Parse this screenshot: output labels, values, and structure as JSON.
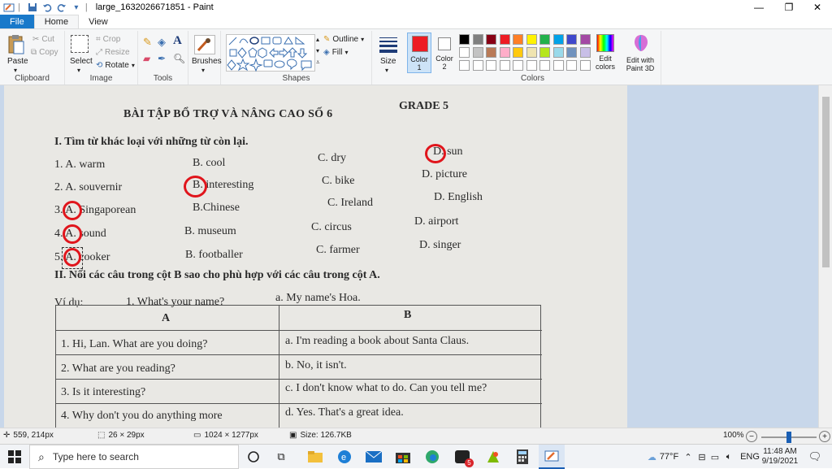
{
  "window": {
    "title": "large_1632026671851 - Paint",
    "qat_separator": "|"
  },
  "tabs": [
    "File",
    "Home",
    "View"
  ],
  "ribbon": {
    "clipboard": {
      "label": "Clipboard",
      "paste": "Paste",
      "cut": "Cut",
      "copy": "Copy"
    },
    "image": {
      "label": "Image",
      "select": "Select",
      "crop": "Crop",
      "resize": "Resize",
      "rotate": "Rotate"
    },
    "tools": {
      "label": "Tools"
    },
    "brushes": {
      "label": "Brushes"
    },
    "shapes": {
      "label": "Shapes",
      "outline": "Outline",
      "fill": "Fill"
    },
    "size": {
      "label": "Size"
    },
    "colors": {
      "label": "Colors",
      "color1": "Color 1",
      "color2": "Color 2",
      "edit_colors": "Edit colors",
      "edit_paint3d": "Edit with Paint 3D",
      "color1_value": "#ed1c24",
      "color2_value": "#ffffff",
      "palette_row1": [
        "#000000",
        "#7f7f7f",
        "#880015",
        "#ed1c24",
        "#ff7f27",
        "#fff200",
        "#22b14c",
        "#00a2e8",
        "#3f48cc",
        "#a349a4"
      ],
      "palette_row2": [
        "#ffffff",
        "#c3c3c3",
        "#b97a57",
        "#ffaec9",
        "#ffc90e",
        "#efe4b0",
        "#b5e61d",
        "#99d9ea",
        "#7092be",
        "#c8bfe7"
      ]
    }
  },
  "document": {
    "title": "BÀI TẬP BỔ TRỢ VÀ NÂNG CAO SỐ 6",
    "grade": "GRADE 5",
    "section1": "I. Tìm từ khác loại với những từ còn lại.",
    "rows": [
      [
        "1. A. warm",
        "B. cool",
        "C. dry",
        "D. sun"
      ],
      [
        "2. A. souvernir",
        "B. interesting",
        "C. bike",
        "D. picture"
      ],
      [
        "3. A. Singaporean",
        "B.Chinese",
        "C. Ireland",
        "D. English"
      ],
      [
        "4. A. sound",
        "B. museum",
        "C. circus",
        "D. airport"
      ],
      [
        "5. A. cooker",
        "B. footballer",
        "C. farmer",
        "D. singer"
      ]
    ],
    "section2": "II. Nối các câu trong cột B sao cho phù hợp với các câu trong cột A.",
    "example_label": "Ví dụ:",
    "example_q": "1. What's your name?",
    "example_a": "a. My name's Hoa.",
    "table": {
      "headers": [
        "A",
        "B"
      ],
      "rows": [
        [
          "1. Hi, Lan. What are you doing?",
          "a. I'm reading a book about Santa Claus."
        ],
        [
          "2. What are you reading?",
          "b. No, it isn't."
        ],
        [
          "3. Is it interesting?",
          "c. I don't know what to do. Can you tell me?"
        ],
        [
          "4. Why don't you do anything more",
          "d. Yes. That's a great idea."
        ]
      ]
    }
  },
  "status": {
    "cursor": "559, 214px",
    "selection": "26 × 29px",
    "image_size": "1024 × 1277px",
    "file_size": "Size: 126.7KB",
    "zoom": "100%",
    "zoom_level": 0.5
  },
  "taskbar": {
    "search_placeholder": "Type here to search",
    "weather": "77°F",
    "language": "ENG",
    "time": "11:48 AM",
    "date": "9/19/2021",
    "mail_badge": "5"
  }
}
